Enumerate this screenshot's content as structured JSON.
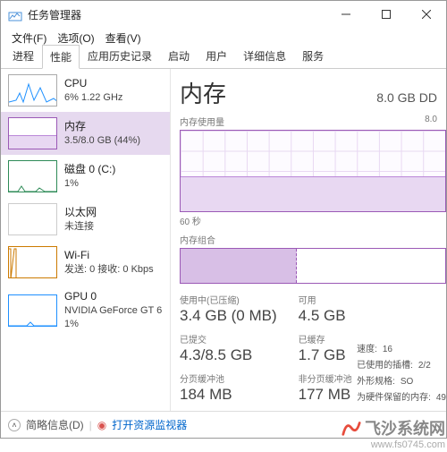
{
  "title": "任务管理器",
  "menu": {
    "file": "文件(F)",
    "options": "选项(O)",
    "view": "查看(V)"
  },
  "tabs": {
    "t0": "进程",
    "t1": "性能",
    "t2": "应用历史记录",
    "t3": "启动",
    "t4": "用户",
    "t5": "详细信息",
    "t6": "服务"
  },
  "sidebar": {
    "cpu": {
      "title": "CPU",
      "sub": "6%  1.22 GHz"
    },
    "mem": {
      "title": "内存",
      "sub": "3.5/8.0 GB (44%)"
    },
    "disk": {
      "title": "磁盘 0 (C:)",
      "sub": "1%"
    },
    "eth": {
      "title": "以太网",
      "sub": "未连接"
    },
    "wifi": {
      "title": "Wi-Fi",
      "sub": "发送: 0 接收: 0 Kbps"
    },
    "gpu": {
      "title": "GPU 0",
      "sub": "NVIDIA GeForce GT 6",
      "sub2": "1%"
    }
  },
  "main": {
    "title": "内存",
    "right": "8.0 GB DD",
    "usage_label": "内存使用量",
    "usage_max": "8.0",
    "time_label": "60 秒",
    "compose_label": "内存组合"
  },
  "stats": {
    "used_label": "使用中(已压缩)",
    "used_val": "3.4 GB (0 MB)",
    "avail_label": "可用",
    "avail_val": "4.5 GB",
    "commit_label": "已提交",
    "commit_val": "4.3/8.5 GB",
    "cache_label": "已缓存",
    "cache_val": "1.7 GB",
    "paged_label": "分页缓冲池",
    "paged_val": "184 MB",
    "nonpaged_label": "非分页缓冲池",
    "nonpaged_val": "177 MB"
  },
  "rstats": {
    "speed_l": "速度:",
    "speed_v": "16",
    "slots_l": "已使用的插槽:",
    "slots_v": "2/2",
    "form_l": "外形规格:",
    "form_v": "SO",
    "hw_l": "为硬件保留的内存:",
    "hw_v": "49"
  },
  "bottom": {
    "brief": "简略信息(D)",
    "monitor": "打开资源监视器"
  },
  "chart_data": {
    "type": "area",
    "title": "内存使用量",
    "ylim": [
      0,
      8.0
    ],
    "ylabel": "GB",
    "xrange_seconds": 60,
    "series": [
      {
        "name": "内存",
        "values": [
          3.5,
          3.5,
          3.5,
          3.5,
          3.5,
          3.5,
          3.5,
          3.5,
          3.5,
          3.5,
          3.5,
          3.5,
          3.5,
          3.5,
          3.5,
          3.5,
          3.5,
          3.5,
          3.5,
          3.5
        ]
      }
    ],
    "composition": {
      "in_use_gb": 3.4,
      "compressed_mb": 0,
      "available_gb": 4.5,
      "total_gb": 8.0
    }
  },
  "watermark": {
    "brand": "飞沙系统网",
    "url": "www.fs0745.com"
  }
}
